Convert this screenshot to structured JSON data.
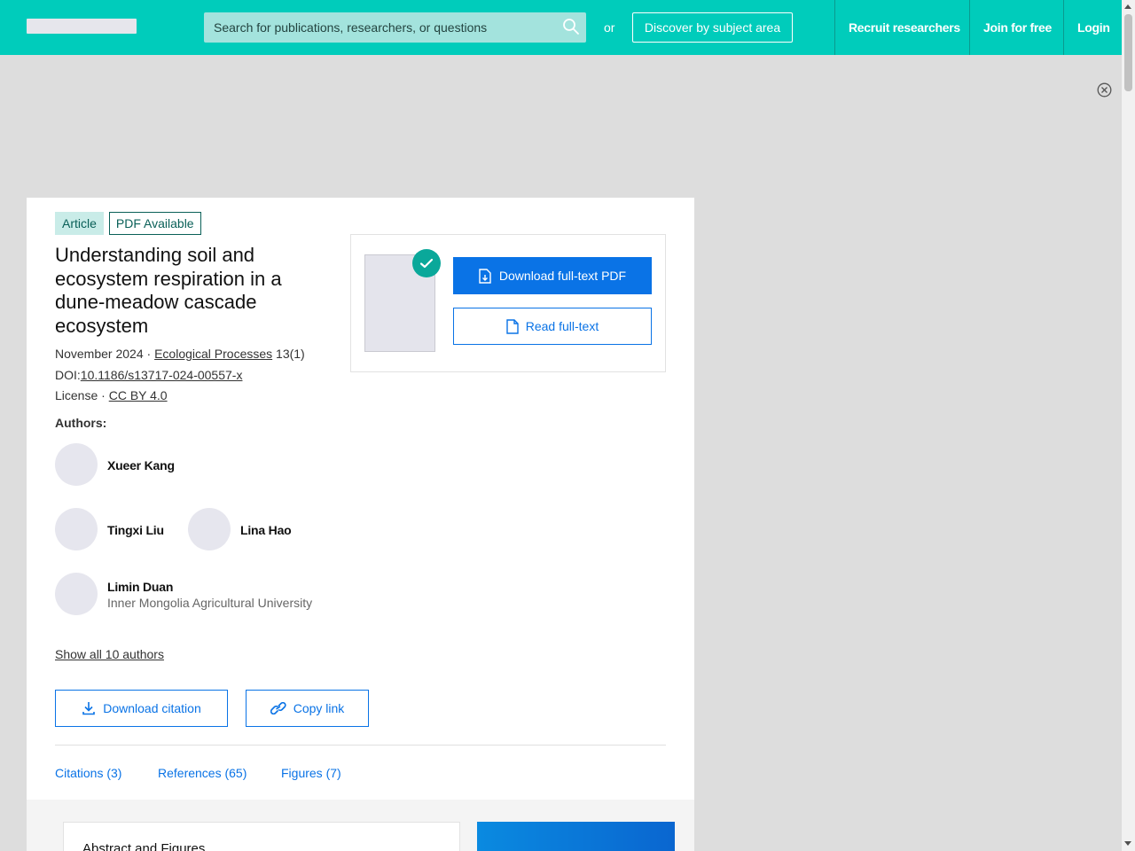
{
  "header": {
    "search_placeholder": "Search for publications, researchers, or questions",
    "or_text": "or",
    "discover_label": "Discover by subject area",
    "recruit_label": "Recruit researchers",
    "join_label": "Join for free",
    "login_label": "Login",
    "brand_color": "#00ccbb"
  },
  "article": {
    "type_tag": "Article",
    "pdf_tag": "PDF Available",
    "title": "Understanding soil and ecosystem respiration in a dune-meadow cascade ecosystem",
    "date": "November 2024",
    "separator": " · ",
    "journal": "Ecological Processes",
    "issue": " 13(1)",
    "doi_label": "DOI:",
    "doi": "10.1186/s13717-024-00557-x",
    "license_label": "License · ",
    "license": "CC BY 4.0"
  },
  "authors": {
    "label": "Authors:",
    "list": [
      {
        "name": "Xueer Kang",
        "affiliation": ""
      },
      {
        "name": "Tingxi Liu",
        "affiliation": ""
      },
      {
        "name": "Lina Hao",
        "affiliation": ""
      },
      {
        "name": "Limin Duan",
        "affiliation": "Inner Mongolia Agricultural University"
      }
    ],
    "show_all": "Show all 10 authors"
  },
  "actions": {
    "download_citation": "Download citation",
    "copy_link": "Copy link",
    "download_pdf": "Download full-text PDF",
    "read_fulltext": "Read full-text"
  },
  "tabs": {
    "citations": "Citations (3)",
    "references": "References (65)",
    "figures": "Figures (7)"
  },
  "lower": {
    "abstract_title": "Abstract and Figures"
  }
}
